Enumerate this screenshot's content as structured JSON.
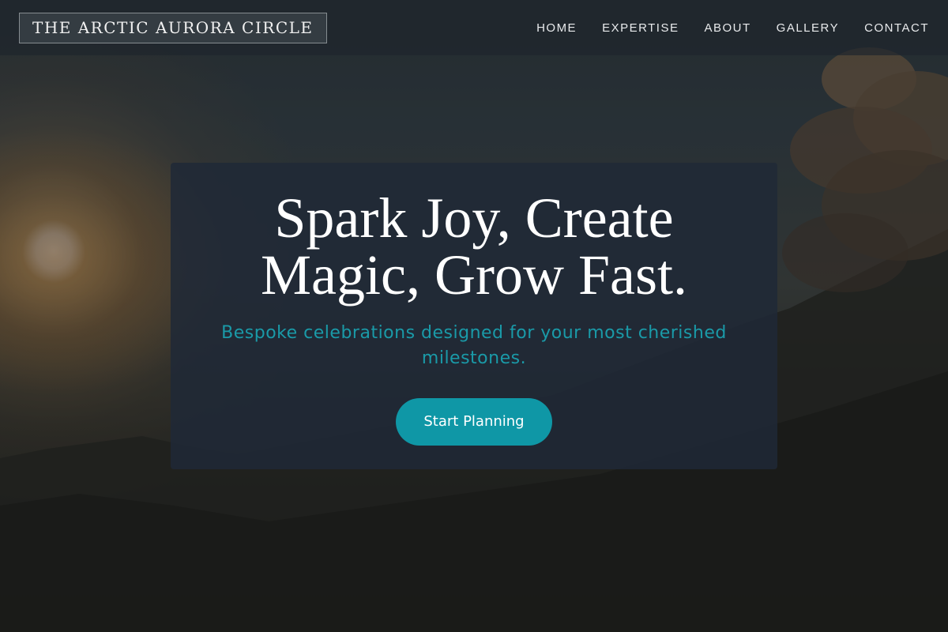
{
  "brand": {
    "name": "THE ARCTIC AURORA CIRCLE"
  },
  "nav": {
    "items": [
      {
        "label": "HOME"
      },
      {
        "label": "EXPERTISE"
      },
      {
        "label": "ABOUT"
      },
      {
        "label": "GALLERY"
      },
      {
        "label": "CONTACT"
      }
    ]
  },
  "hero": {
    "title_line1": "Spark Joy, Create",
    "title_line2": "Magic, Grow Fast.",
    "subtitle_line1": "Bespoke celebrations designed for your most cherished",
    "subtitle_line2": "milestones.",
    "cta_label": "Start Planning",
    "background_icon": "sunset-mountain-image"
  },
  "colors": {
    "accent": "#0f97a6",
    "subtitle": "#1a9aa8",
    "card": "#1f2937",
    "nav_bg": "#1e262c"
  }
}
